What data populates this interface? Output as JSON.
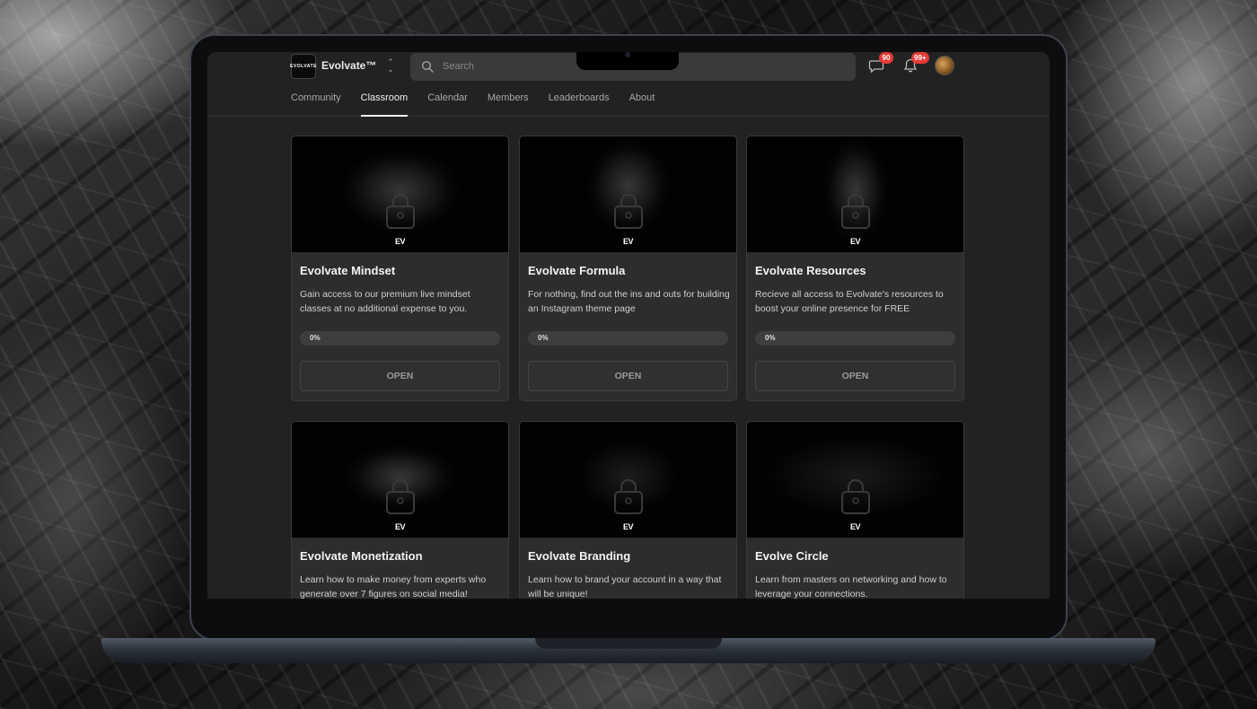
{
  "app": {
    "brand_name": "Evolvate™",
    "logo_text": "EVOLVATE"
  },
  "search": {
    "placeholder": "Search"
  },
  "header": {
    "chat_badge": "90",
    "notifications_badge": "99+"
  },
  "tabs": [
    {
      "label": "Community"
    },
    {
      "label": "Classroom",
      "active": true
    },
    {
      "label": "Calendar"
    },
    {
      "label": "Members"
    },
    {
      "label": "Leaderboards"
    },
    {
      "label": "About"
    }
  ],
  "courses": [
    {
      "title": "Evolvate Mindset",
      "description": "Gain access to our premium live mindset classes at no additional expense to you.",
      "progress_label": "0%",
      "progress": 0,
      "button": "OPEN",
      "cover_icon": "tiger-face-icon",
      "cover_mark": "EV"
    },
    {
      "title": "Evolvate Formula",
      "description": "For nothing, find out the ins and outs for building an Instagram theme page",
      "progress_label": "0%",
      "progress": 0,
      "button": "OPEN",
      "cover_icon": "ink-bottle-icon",
      "cover_mark": "EV"
    },
    {
      "title": "Evolvate Resources",
      "description": "Recieve all access to Evolvate's resources to boost your online presence for FREE",
      "progress_label": "0%",
      "progress": 0,
      "button": "OPEN",
      "cover_icon": "phone-icon",
      "cover_mark": "EV"
    },
    {
      "title": "Evolvate Monetization",
      "description": "Learn how to make money from experts who generate over 7 figures on social media!",
      "cover_icon": "money-stack-icon",
      "cover_mark": "EV"
    },
    {
      "title": "Evolvate Branding",
      "description": "Learn how to brand your account in a way that will be unique!",
      "cover_icon": "pen-hand-icon",
      "cover_mark": "EV"
    },
    {
      "title": "Evolve Circle",
      "description": "Learn from masters on networking and how to leverage your connections.",
      "cover_icon": "suits-icon",
      "cover_mark": "EV"
    }
  ]
}
